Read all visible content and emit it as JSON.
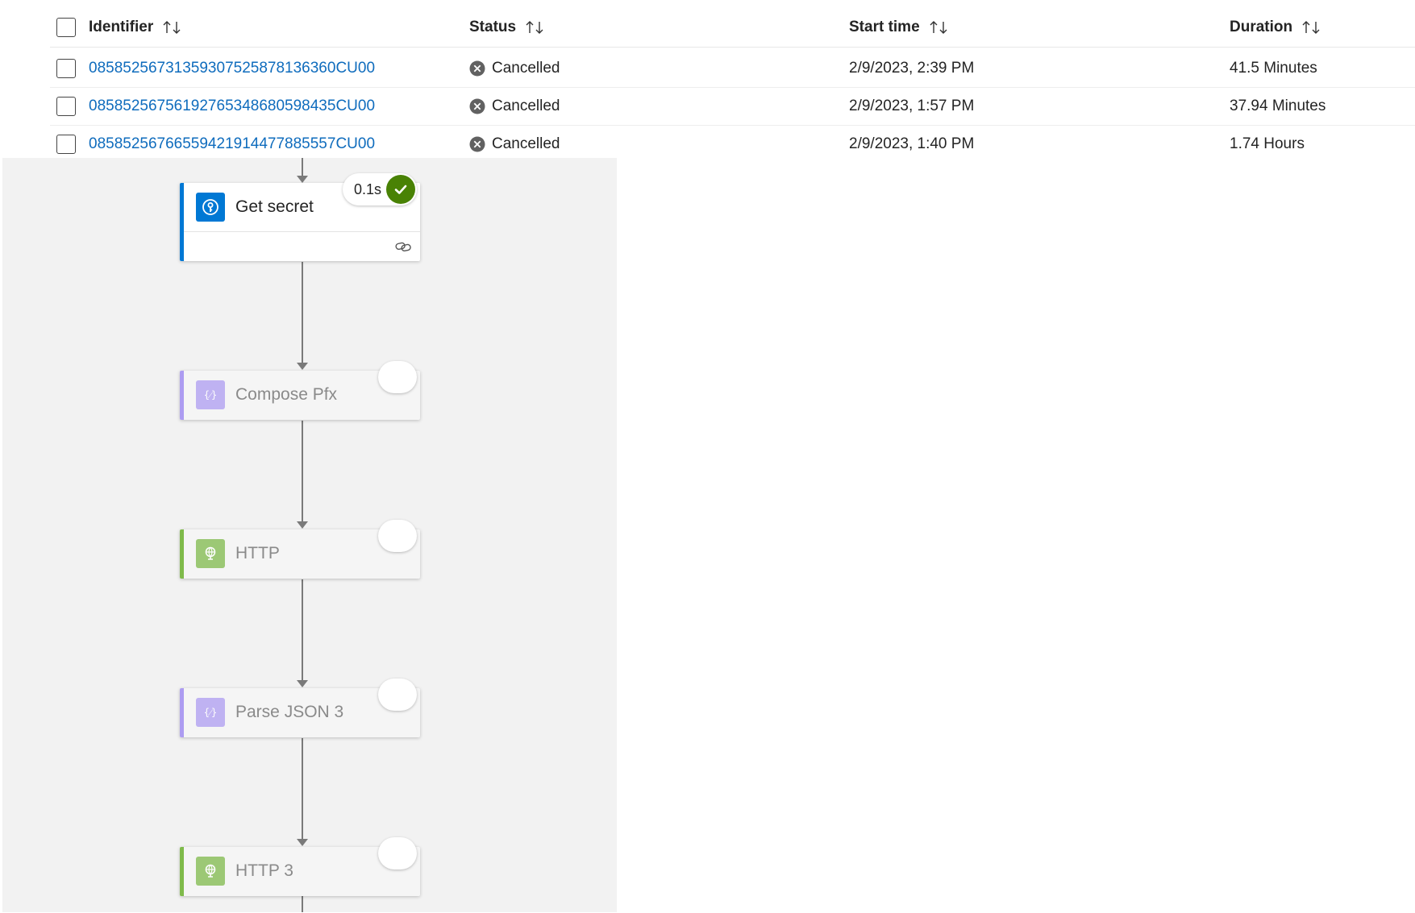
{
  "table": {
    "columns": [
      {
        "label": "Identifier"
      },
      {
        "label": "Status"
      },
      {
        "label": "Start time"
      },
      {
        "label": "Duration"
      }
    ],
    "rows": [
      {
        "id": "08585256731359307525878136360CU00",
        "status": "Cancelled",
        "start": "2/9/2023, 2:39 PM",
        "duration": "41.5 Minutes"
      },
      {
        "id": "08585256756192765348680598435CU00",
        "status": "Cancelled",
        "start": "2/9/2023, 1:57 PM",
        "duration": "37.94 Minutes"
      },
      {
        "id": "08585256766559421914477885557CU00",
        "status": "Cancelled",
        "start": "2/9/2023, 1:40 PM",
        "duration": "1.74 Hours"
      }
    ]
  },
  "designer": {
    "steps": [
      {
        "title": "Get secret",
        "duration": "0.1s",
        "icon": "key-vault-icon",
        "state": "succeeded",
        "accent": "#0078d4"
      },
      {
        "title": "Compose Pfx",
        "icon": "compose-icon",
        "state": "skipped",
        "accent": "#ad9cf1"
      },
      {
        "title": "HTTP",
        "icon": "http-globe-icon",
        "state": "skipped",
        "accent": "#7fba4b"
      },
      {
        "title": "Parse JSON 3",
        "icon": "parse-json-icon",
        "state": "skipped",
        "accent": "#ad9cf1"
      },
      {
        "title": "HTTP 3",
        "icon": "http-globe-icon",
        "state": "skipped",
        "accent": "#7fba4b"
      }
    ]
  },
  "colors": {
    "link": "#0f6cbd",
    "success": "#498205",
    "canvas": "#f2f2f2"
  }
}
